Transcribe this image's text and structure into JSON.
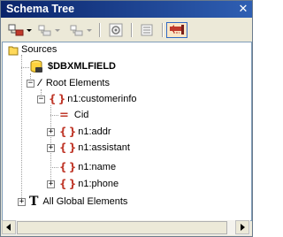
{
  "window": {
    "title": "Schema Tree",
    "close_glyph": "✕"
  },
  "toolbar": {
    "buttons": [
      {
        "name": "add-child-button",
        "icon": "insert-child-icon",
        "has_dropdown": true
      },
      {
        "name": "insert-before-button",
        "icon": "insert-before-icon",
        "has_dropdown": true
      },
      {
        "name": "append-button",
        "icon": "append-icon",
        "has_dropdown": true
      },
      {
        "name": "properties-button",
        "icon": "gear-icon"
      },
      {
        "name": "fields-button",
        "icon": "fields-icon"
      },
      {
        "name": "return-button",
        "icon": "return-arrow-icon"
      }
    ]
  },
  "tree": {
    "root_label": "Sources",
    "source": {
      "label": "$DBXMLFIELD"
    },
    "root_elements": {
      "label": "Root Elements",
      "icon_glyph": "∕"
    },
    "customerinfo": {
      "label": "n1:customerinfo"
    },
    "cid": {
      "label": "Cid",
      "icon_glyph": "="
    },
    "addr": {
      "label": "n1:addr"
    },
    "assistant": {
      "label": "n1:assistant"
    },
    "name": {
      "label": "n1:name"
    },
    "phone": {
      "label": "n1:phone"
    },
    "global": {
      "label": "All Global Elements",
      "icon_glyph": "T"
    },
    "element_glyph": "{ }",
    "expand_glyph": "+",
    "collapse_glyph": "−"
  }
}
